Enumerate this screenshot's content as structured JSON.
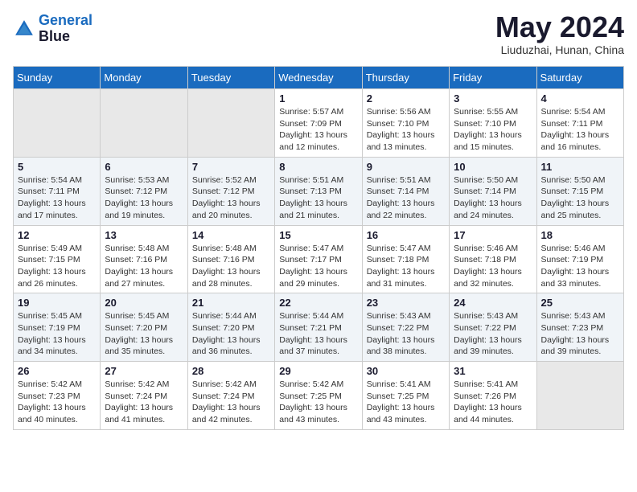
{
  "header": {
    "logo_line1": "General",
    "logo_line2": "Blue",
    "month_title": "May 2024",
    "location": "Liuduzhai, Hunan, China"
  },
  "weekdays": [
    "Sunday",
    "Monday",
    "Tuesday",
    "Wednesday",
    "Thursday",
    "Friday",
    "Saturday"
  ],
  "weeks": [
    [
      {
        "day": "",
        "sunrise": "",
        "sunset": "",
        "daylight": ""
      },
      {
        "day": "",
        "sunrise": "",
        "sunset": "",
        "daylight": ""
      },
      {
        "day": "",
        "sunrise": "",
        "sunset": "",
        "daylight": ""
      },
      {
        "day": "1",
        "sunrise": "Sunrise: 5:57 AM",
        "sunset": "Sunset: 7:09 PM",
        "daylight": "Daylight: 13 hours and 12 minutes."
      },
      {
        "day": "2",
        "sunrise": "Sunrise: 5:56 AM",
        "sunset": "Sunset: 7:10 PM",
        "daylight": "Daylight: 13 hours and 13 minutes."
      },
      {
        "day": "3",
        "sunrise": "Sunrise: 5:55 AM",
        "sunset": "Sunset: 7:10 PM",
        "daylight": "Daylight: 13 hours and 15 minutes."
      },
      {
        "day": "4",
        "sunrise": "Sunrise: 5:54 AM",
        "sunset": "Sunset: 7:11 PM",
        "daylight": "Daylight: 13 hours and 16 minutes."
      }
    ],
    [
      {
        "day": "5",
        "sunrise": "Sunrise: 5:54 AM",
        "sunset": "Sunset: 7:11 PM",
        "daylight": "Daylight: 13 hours and 17 minutes."
      },
      {
        "day": "6",
        "sunrise": "Sunrise: 5:53 AM",
        "sunset": "Sunset: 7:12 PM",
        "daylight": "Daylight: 13 hours and 19 minutes."
      },
      {
        "day": "7",
        "sunrise": "Sunrise: 5:52 AM",
        "sunset": "Sunset: 7:12 PM",
        "daylight": "Daylight: 13 hours and 20 minutes."
      },
      {
        "day": "8",
        "sunrise": "Sunrise: 5:51 AM",
        "sunset": "Sunset: 7:13 PM",
        "daylight": "Daylight: 13 hours and 21 minutes."
      },
      {
        "day": "9",
        "sunrise": "Sunrise: 5:51 AM",
        "sunset": "Sunset: 7:14 PM",
        "daylight": "Daylight: 13 hours and 22 minutes."
      },
      {
        "day": "10",
        "sunrise": "Sunrise: 5:50 AM",
        "sunset": "Sunset: 7:14 PM",
        "daylight": "Daylight: 13 hours and 24 minutes."
      },
      {
        "day": "11",
        "sunrise": "Sunrise: 5:50 AM",
        "sunset": "Sunset: 7:15 PM",
        "daylight": "Daylight: 13 hours and 25 minutes."
      }
    ],
    [
      {
        "day": "12",
        "sunrise": "Sunrise: 5:49 AM",
        "sunset": "Sunset: 7:15 PM",
        "daylight": "Daylight: 13 hours and 26 minutes."
      },
      {
        "day": "13",
        "sunrise": "Sunrise: 5:48 AM",
        "sunset": "Sunset: 7:16 PM",
        "daylight": "Daylight: 13 hours and 27 minutes."
      },
      {
        "day": "14",
        "sunrise": "Sunrise: 5:48 AM",
        "sunset": "Sunset: 7:16 PM",
        "daylight": "Daylight: 13 hours and 28 minutes."
      },
      {
        "day": "15",
        "sunrise": "Sunrise: 5:47 AM",
        "sunset": "Sunset: 7:17 PM",
        "daylight": "Daylight: 13 hours and 29 minutes."
      },
      {
        "day": "16",
        "sunrise": "Sunrise: 5:47 AM",
        "sunset": "Sunset: 7:18 PM",
        "daylight": "Daylight: 13 hours and 31 minutes."
      },
      {
        "day": "17",
        "sunrise": "Sunrise: 5:46 AM",
        "sunset": "Sunset: 7:18 PM",
        "daylight": "Daylight: 13 hours and 32 minutes."
      },
      {
        "day": "18",
        "sunrise": "Sunrise: 5:46 AM",
        "sunset": "Sunset: 7:19 PM",
        "daylight": "Daylight: 13 hours and 33 minutes."
      }
    ],
    [
      {
        "day": "19",
        "sunrise": "Sunrise: 5:45 AM",
        "sunset": "Sunset: 7:19 PM",
        "daylight": "Daylight: 13 hours and 34 minutes."
      },
      {
        "day": "20",
        "sunrise": "Sunrise: 5:45 AM",
        "sunset": "Sunset: 7:20 PM",
        "daylight": "Daylight: 13 hours and 35 minutes."
      },
      {
        "day": "21",
        "sunrise": "Sunrise: 5:44 AM",
        "sunset": "Sunset: 7:20 PM",
        "daylight": "Daylight: 13 hours and 36 minutes."
      },
      {
        "day": "22",
        "sunrise": "Sunrise: 5:44 AM",
        "sunset": "Sunset: 7:21 PM",
        "daylight": "Daylight: 13 hours and 37 minutes."
      },
      {
        "day": "23",
        "sunrise": "Sunrise: 5:43 AM",
        "sunset": "Sunset: 7:22 PM",
        "daylight": "Daylight: 13 hours and 38 minutes."
      },
      {
        "day": "24",
        "sunrise": "Sunrise: 5:43 AM",
        "sunset": "Sunset: 7:22 PM",
        "daylight": "Daylight: 13 hours and 39 minutes."
      },
      {
        "day": "25",
        "sunrise": "Sunrise: 5:43 AM",
        "sunset": "Sunset: 7:23 PM",
        "daylight": "Daylight: 13 hours and 39 minutes."
      }
    ],
    [
      {
        "day": "26",
        "sunrise": "Sunrise: 5:42 AM",
        "sunset": "Sunset: 7:23 PM",
        "daylight": "Daylight: 13 hours and 40 minutes."
      },
      {
        "day": "27",
        "sunrise": "Sunrise: 5:42 AM",
        "sunset": "Sunset: 7:24 PM",
        "daylight": "Daylight: 13 hours and 41 minutes."
      },
      {
        "day": "28",
        "sunrise": "Sunrise: 5:42 AM",
        "sunset": "Sunset: 7:24 PM",
        "daylight": "Daylight: 13 hours and 42 minutes."
      },
      {
        "day": "29",
        "sunrise": "Sunrise: 5:42 AM",
        "sunset": "Sunset: 7:25 PM",
        "daylight": "Daylight: 13 hours and 43 minutes."
      },
      {
        "day": "30",
        "sunrise": "Sunrise: 5:41 AM",
        "sunset": "Sunset: 7:25 PM",
        "daylight": "Daylight: 13 hours and 43 minutes."
      },
      {
        "day": "31",
        "sunrise": "Sunrise: 5:41 AM",
        "sunset": "Sunset: 7:26 PM",
        "daylight": "Daylight: 13 hours and 44 minutes."
      },
      {
        "day": "",
        "sunrise": "",
        "sunset": "",
        "daylight": ""
      }
    ]
  ]
}
